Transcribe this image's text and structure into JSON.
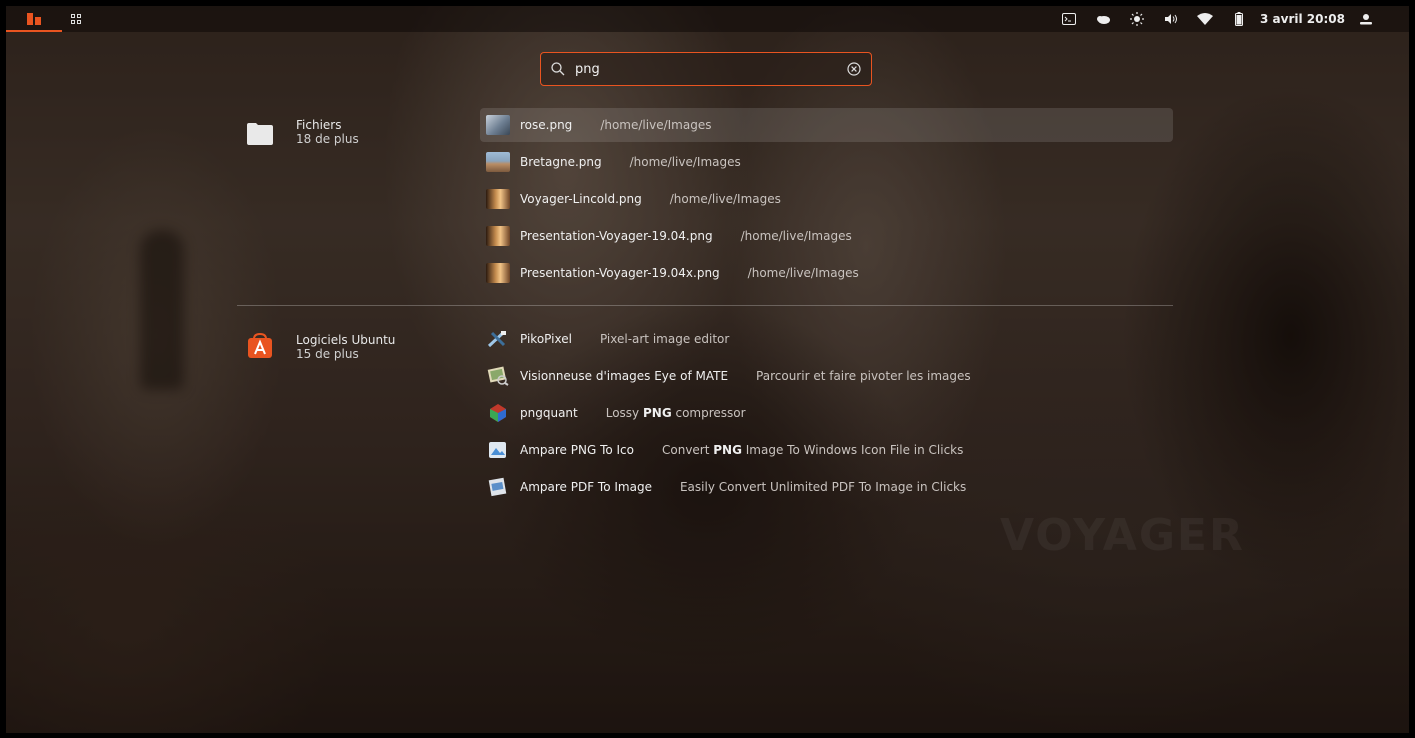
{
  "topbar": {
    "activities_icon": "ubuntu-activities-icon",
    "apps_icon": "app-grid-icon",
    "tray_icons": [
      "terminal-icon",
      "weather-icon",
      "brightness-icon",
      "volume-icon",
      "wifi-icon",
      "battery-icon"
    ],
    "clock": "3 avril 20:08",
    "user_icon": "user-icon"
  },
  "search": {
    "query": "png",
    "icon": "search-icon",
    "clear_icon": "clear-icon"
  },
  "categories": [
    {
      "name": "Fichiers",
      "more": "18 de plus",
      "icon": "folder-icon",
      "results": [
        {
          "name": "rose.png",
          "desc": "/home/live/Images",
          "thumb": "rose-thumbnail",
          "selected": true
        },
        {
          "name": "Bretagne.png",
          "desc": "/home/live/Images",
          "thumb": "bretagne-thumbnail"
        },
        {
          "name": "Voyager-Lincold.png",
          "desc": "/home/live/Images",
          "thumb": "voyager-thumbnail"
        },
        {
          "name": "Presentation-Voyager-19.04.png",
          "desc": "/home/live/Images",
          "thumb": "voyager-thumbnail"
        },
        {
          "name": "Presentation-Voyager-19.04x.png",
          "desc": "/home/live/Images",
          "thumb": "voyager-thumbnail"
        }
      ]
    },
    {
      "name": "Logiciels Ubuntu",
      "more": "15 de plus",
      "icon": "ubuntu-software-icon",
      "results": [
        {
          "name": "PikoPixel",
          "desc": "Pixel-art image editor",
          "thumb": "pikopixel-icon"
        },
        {
          "name": "Visionneuse d'images Eye of MATE",
          "desc": "Parcourir et faire pivoter les images",
          "thumb": "eom-icon"
        },
        {
          "name": "pngquant",
          "desc_pre": "Lossy ",
          "desc_bold": "PNG",
          "desc_post": " compressor",
          "thumb": "pngquant-icon"
        },
        {
          "name": "Ampare PNG To Ico",
          "desc_pre": "Convert ",
          "desc_bold": "PNG",
          "desc_post": " Image To Windows Icon File in Clicks",
          "thumb": "ampare-png-icon"
        },
        {
          "name": "Ampare PDF To Image",
          "desc": "Easily Convert Unlimited PDF To Image in Clicks",
          "thumb": "ampare-pdf-icon"
        }
      ]
    }
  ],
  "colors": {
    "accent": "#e95420",
    "text": "#f0f0f0",
    "muted": "#c9c3bf"
  }
}
